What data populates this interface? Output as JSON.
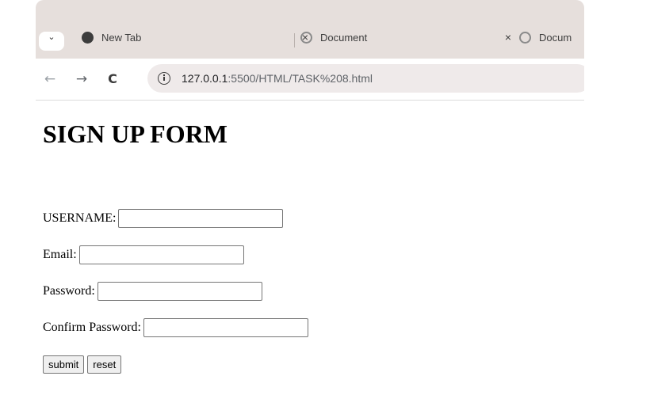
{
  "browser": {
    "tabs": [
      {
        "title": "New Tab",
        "close": "×"
      },
      {
        "title": "Document",
        "close": "×"
      },
      {
        "title": "Docum"
      }
    ],
    "nav": {
      "back": "←",
      "forward": "→",
      "reload": "C"
    },
    "url": {
      "host": "127.0.0.1",
      "rest": ":5500/HTML/TASK%208.html"
    }
  },
  "page": {
    "title": "SIGN UP FORM",
    "fields": [
      {
        "label": "USERNAME:",
        "value": ""
      },
      {
        "label": "Email:",
        "value": ""
      },
      {
        "label": "Password:",
        "value": ""
      },
      {
        "label": "Confirm Password:",
        "value": ""
      }
    ],
    "buttons": {
      "submit": "submit",
      "reset": "reset"
    }
  }
}
